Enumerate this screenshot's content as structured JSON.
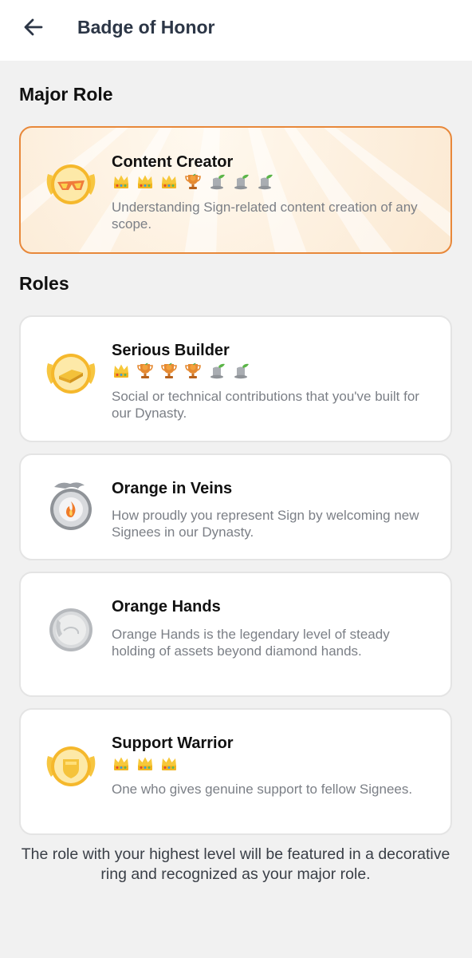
{
  "header": {
    "title": "Badge of Honor",
    "back_icon": "arrow-left-icon"
  },
  "major_section": {
    "title": "Major Role"
  },
  "roles_section": {
    "title": "Roles"
  },
  "major_role": {
    "name": "Content Creator",
    "badge_icon": "sunglasses-badge-icon",
    "levels": [
      "crown",
      "crown",
      "crown",
      "trophy",
      "tophat",
      "tophat",
      "tophat"
    ],
    "description": "Understanding Sign-related content creation of any scope."
  },
  "roles": [
    {
      "name": "Serious Builder",
      "badge_icon": "brick-badge-icon",
      "levels": [
        "crown",
        "trophy",
        "trophy",
        "trophy",
        "tophat",
        "tophat"
      ],
      "description": "Social or technical contributions that you've built for our Dynasty."
    },
    {
      "name": "Orange in Veins",
      "badge_icon": "dragon-flame-badge-icon",
      "levels": [],
      "description": "How proudly you represent Sign by welcoming new Signees in our Dynasty."
    },
    {
      "name": "Orange Hands",
      "badge_icon": "silver-coin-badge-icon",
      "levels": [],
      "description": "Orange Hands is the legendary level of steady holding of assets beyond diamond hands."
    },
    {
      "name": "Support Warrior",
      "badge_icon": "shield-badge-icon",
      "levels": [
        "crown",
        "crown",
        "crown"
      ],
      "description": "One who gives genuine support to fellow Signees."
    }
  ],
  "footer_note": "The role with your highest level will be featured in a decorative ring and recognized as your major role.",
  "colors": {
    "accent": "#e8883a",
    "gold": "#f5c33b",
    "text_muted": "#7b7f86"
  }
}
